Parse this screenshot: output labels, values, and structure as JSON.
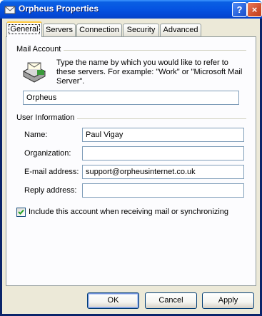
{
  "window": {
    "title": "Orpheus Properties",
    "help_glyph": "?",
    "close_glyph": "×"
  },
  "tabs": [
    {
      "label": "General",
      "active": true
    },
    {
      "label": "Servers",
      "active": false
    },
    {
      "label": "Connection",
      "active": false
    },
    {
      "label": "Security",
      "active": false
    },
    {
      "label": "Advanced",
      "active": false
    }
  ],
  "mail_account": {
    "group_label": "Mail Account",
    "description": "Type the name by which you would like to refer to these servers.  For example: \"Work\" or \"Microsoft Mail Server\".",
    "account_name": "Orpheus"
  },
  "user_information": {
    "group_label": "User Information",
    "name_label": "Name:",
    "name_value": "Paul Vigay",
    "organization_label": "Organization:",
    "organization_value": "",
    "email_label": "E-mail address:",
    "email_value": "support@orpheusinternet.co.uk",
    "reply_label": "Reply address:",
    "reply_value": ""
  },
  "include_account": {
    "label": "Include this account when receiving mail or synchronizing",
    "checked": true
  },
  "buttons": {
    "ok": "OK",
    "cancel": "Cancel",
    "apply": "Apply"
  },
  "colors": {
    "titlebar": "#0553e1",
    "dialog_bg": "#ece9d8",
    "tab_accent": "#ffc83c",
    "checkmark": "#21a121"
  }
}
